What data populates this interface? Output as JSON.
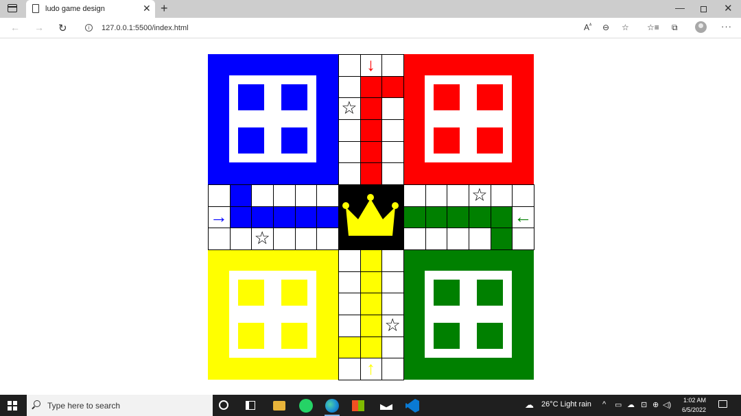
{
  "browser": {
    "tab_title": "ludo game design",
    "url": "127.0.0.1:5500/index.html",
    "icons": [
      "tab-actions-icon",
      "page-icon",
      "close-icon",
      "plus-icon",
      "back-icon",
      "forward-icon",
      "refresh-icon",
      "info-icon",
      "read-aloud-icon",
      "zoom-icon",
      "favorite-icon",
      "favorites-icon",
      "collections-icon",
      "profile-icon",
      "more-icon",
      "minimize-icon",
      "maximize-icon",
      "window-close-icon"
    ]
  },
  "board": {
    "colors": {
      "blue": "#0000ff",
      "red": "#ff0000",
      "yellow": "#ffff00",
      "green": "#008000",
      "center": "#000000",
      "crown": "#ffff00"
    },
    "homes": [
      {
        "name": "blue",
        "color": "#0000ff"
      },
      {
        "name": "red",
        "color": "#ff0000"
      },
      {
        "name": "yellow",
        "color": "#ffff00"
      },
      {
        "name": "green",
        "color": "#008000"
      }
    ],
    "star_glyph": "☆",
    "arrows": {
      "red": "↓",
      "blue": "→",
      "green": "←",
      "yellow": "↑"
    }
  },
  "taskbar": {
    "search_placeholder": "Type here to search",
    "weather": "26°C  Light rain",
    "time": "1:02 AM",
    "date": "6/5/2022",
    "icons": [
      "windows-icon",
      "search-icon",
      "cortana-icon",
      "task-view-icon",
      "file-explorer-icon",
      "whatsapp-icon",
      "edge-icon",
      "store-icon",
      "mail-icon",
      "vscode-icon",
      "weather-icon",
      "notification-icon"
    ]
  }
}
